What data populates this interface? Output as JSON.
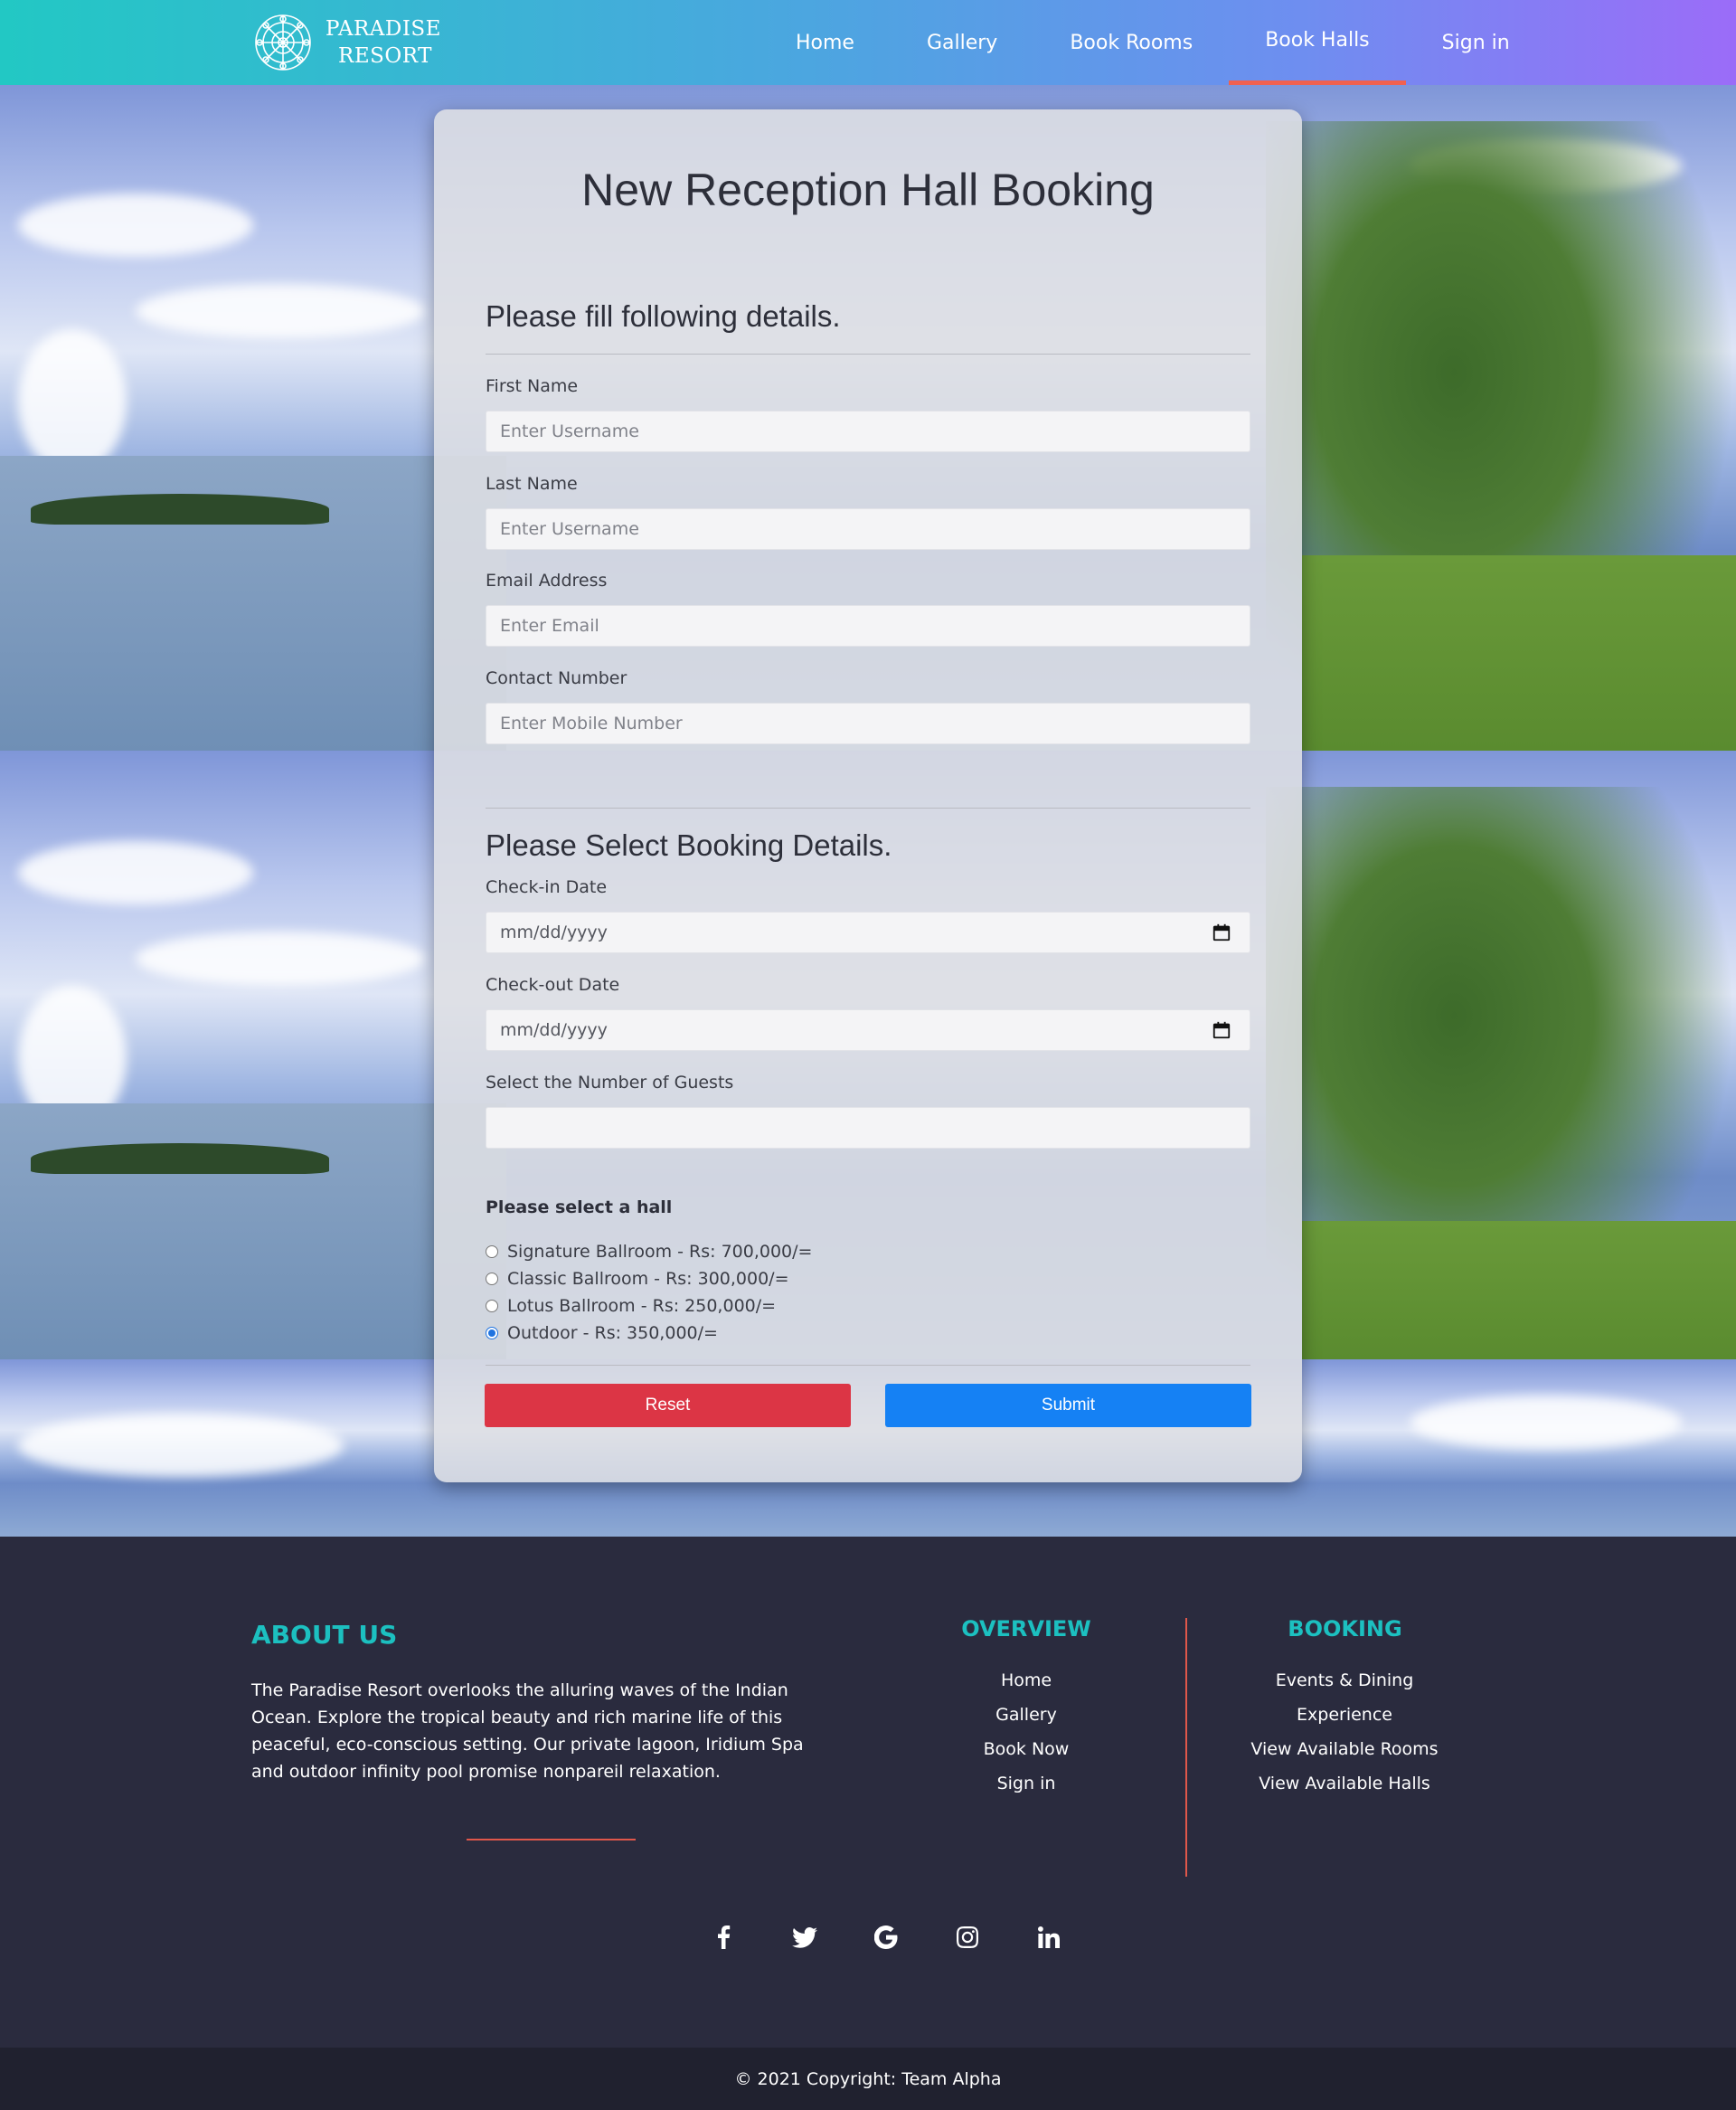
{
  "brand": {
    "line1": "PARADISE",
    "line2": "RESORT"
  },
  "nav": {
    "items": [
      {
        "label": "Home"
      },
      {
        "label": "Gallery"
      },
      {
        "label": "Book Rooms"
      },
      {
        "label": "Book Halls",
        "active": true
      },
      {
        "label": "Sign in"
      }
    ]
  },
  "form": {
    "title": "New Reception Hall Booking",
    "section1": "Please fill following details.",
    "first_name": {
      "label": "First Name",
      "placeholder": "Enter Username"
    },
    "last_name": {
      "label": "Last Name",
      "placeholder": "Enter Username"
    },
    "email": {
      "label": "Email Address",
      "placeholder": "Enter Email"
    },
    "contact": {
      "label": "Contact Number",
      "placeholder": "Enter Mobile Number"
    },
    "section2": "Please Select Booking Details.",
    "checkin": {
      "label": "Check-in Date",
      "placeholder": "mm/dd/yyyy"
    },
    "checkout": {
      "label": "Check-out Date",
      "placeholder": "mm/dd/yyyy"
    },
    "guests": {
      "label": "Select the Number of Guests",
      "value": ""
    },
    "hall_prompt": "Please select a hall",
    "halls": [
      {
        "label": "Signature Ballroom - Rs: 700,000/=",
        "selected": false
      },
      {
        "label": "Classic Ballroom - Rs: 300,000/=",
        "selected": false
      },
      {
        "label": "Lotus Ballroom - Rs: 250,000/=",
        "selected": false
      },
      {
        "label": "Outdoor - Rs: 350,000/=",
        "selected": true
      }
    ],
    "reset_label": "Reset",
    "submit_label": "Submit"
  },
  "footer": {
    "about_title": "ABOUT US",
    "about_text": "The Paradise Resort overlooks the alluring waves of the Indian Ocean. Explore the tropical beauty and rich marine life of this peaceful, eco-conscious setting. Our private lagoon, Iridium Spa and outdoor infinity pool promise nonpareil relaxation.",
    "overview_title": "OVERVIEW",
    "overview_links": [
      "Home",
      "Gallery",
      "Book Now",
      "Sign in"
    ],
    "booking_title": "BOOKING",
    "booking_links": [
      "Events & Dining",
      "Experience",
      "View Available Rooms",
      "View Available Halls"
    ],
    "social_icons": [
      "facebook-icon",
      "twitter-icon",
      "google-icon",
      "instagram-icon",
      "linkedin-icon"
    ],
    "copyright": "© 2021 Copyright: Team Alpha"
  },
  "colors": {
    "accent_teal": "#1cc0c0",
    "accent_red": "#e0574a",
    "reset": "#dc3545",
    "submit": "#1581f4",
    "footer_bg": "#2a2b3e"
  }
}
